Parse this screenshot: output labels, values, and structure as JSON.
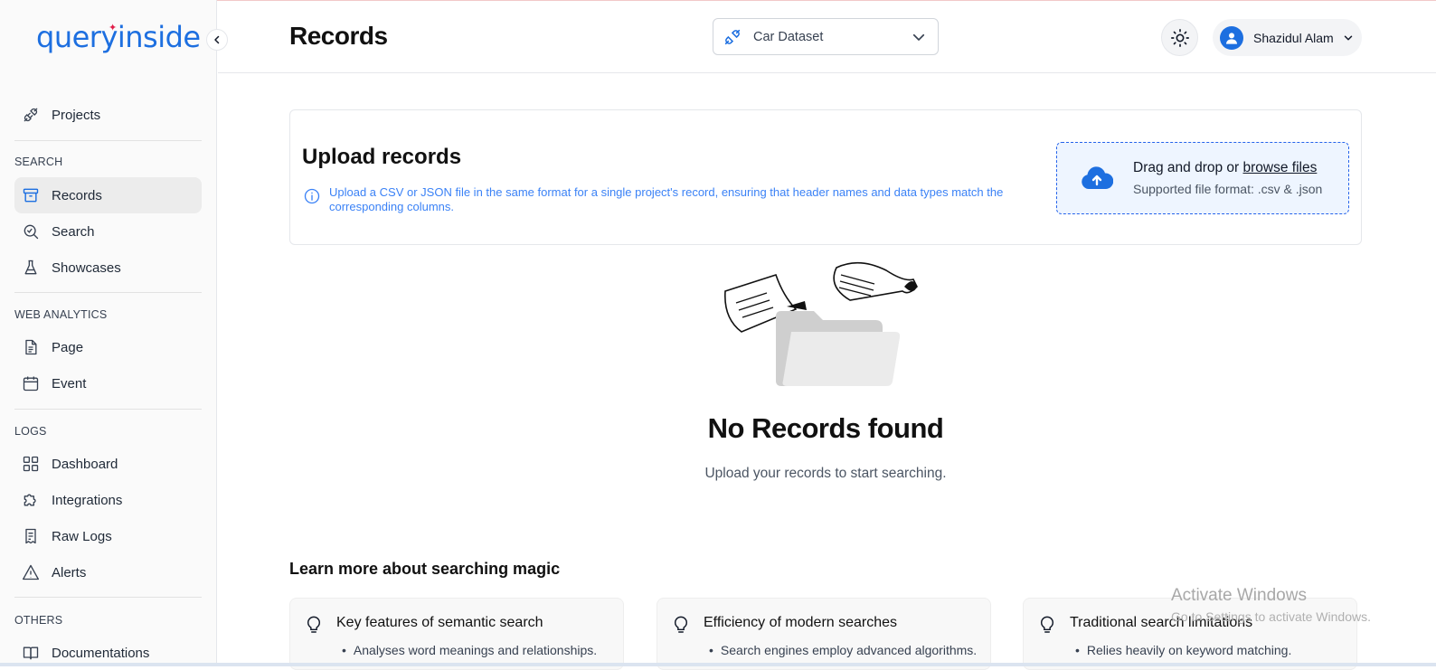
{
  "app": {
    "logo_text": "queryinside"
  },
  "sidebar": {
    "top_items": [
      {
        "label": "Projects",
        "icon": "plug-icon"
      }
    ],
    "sections": [
      {
        "title": "SEARCH",
        "items": [
          {
            "label": "Records",
            "icon": "archive-icon",
            "active": true
          },
          {
            "label": "Search",
            "icon": "search-icon"
          },
          {
            "label": "Showcases",
            "icon": "flask-icon"
          }
        ]
      },
      {
        "title": "WEB ANALYTICS",
        "items": [
          {
            "label": "Page",
            "icon": "document-icon"
          },
          {
            "label": "Event",
            "icon": "calendar-icon"
          }
        ]
      },
      {
        "title": "LOGS",
        "items": [
          {
            "label": "Dashboard",
            "icon": "dashboard-icon"
          },
          {
            "label": "Integrations",
            "icon": "puzzle-icon"
          },
          {
            "label": "Raw Logs",
            "icon": "receipt-icon"
          },
          {
            "label": "Alerts",
            "icon": "warning-icon"
          }
        ]
      },
      {
        "title": "OTHERS",
        "items": [
          {
            "label": "Documentations",
            "icon": "book-icon"
          }
        ]
      }
    ]
  },
  "header": {
    "title": "Records",
    "dataset": "Car Dataset",
    "user_name": "Shazidul Alam"
  },
  "upload": {
    "title": "Upload records",
    "info": "Upload a CSV or JSON file in the same format for a single project's record, ensuring that header names and data types match the corresponding columns.",
    "drop_text": "Drag and drop or",
    "browse_link": "browse files",
    "supported": "Supported file format: .csv & .json"
  },
  "empty": {
    "title": "No Records found",
    "subtitle": "Upload your records to start searching."
  },
  "learn": {
    "title": "Learn more about searching magic",
    "cards": [
      {
        "title": "Key features of semantic search",
        "bullet": "Analyses word meanings and relationships."
      },
      {
        "title": "Efficiency of modern searches",
        "bullet": "Search engines employ advanced algorithms."
      },
      {
        "title": "Traditional search limitations",
        "bullet": "Relies heavily on keyword matching."
      }
    ]
  },
  "watermark": {
    "line1": "Activate Windows",
    "line2": "Go to Settings to activate Windows."
  },
  "colors": {
    "brand": "#1d6fe0",
    "info": "#3b82f6",
    "dropzone_bg": "#eef5ff",
    "active_bg": "#ececec"
  }
}
